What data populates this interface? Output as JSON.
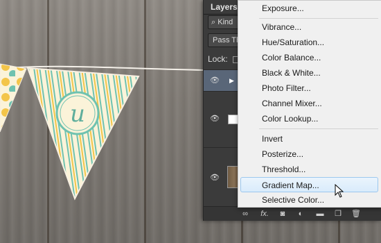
{
  "layers_panel": {
    "tab": "Layers",
    "filter_label": "Kind",
    "blend_label": "Pass Th",
    "lock_label": "Lock:",
    "footer_icons": [
      "link-icon",
      "fx-icon",
      "mask-icon",
      "adjustment-icon",
      "folder-icon",
      "new-layer-icon",
      "trash-icon"
    ],
    "fx_label": "fx."
  },
  "menu": {
    "groups": [
      [
        "Exposure..."
      ],
      [
        "Vibrance...",
        "Hue/Saturation...",
        "Color Balance...",
        "Black & White...",
        "Photo Filter...",
        "Channel Mixer...",
        "Color Lookup..."
      ],
      [
        "Invert",
        "Posterize...",
        "Threshold...",
        "Gradient Map...",
        "Selective Color..."
      ]
    ],
    "hovered": "Gradient Map..."
  },
  "canvas": {
    "letter": "u",
    "colors": {
      "pennant_bg": "#fbf3d9",
      "stripe_teal": "#6fc2b0",
      "stripe_yellow": "#f3c54a",
      "circle_border": "#6fc2b0",
      "letter": "#5fae9c"
    }
  }
}
